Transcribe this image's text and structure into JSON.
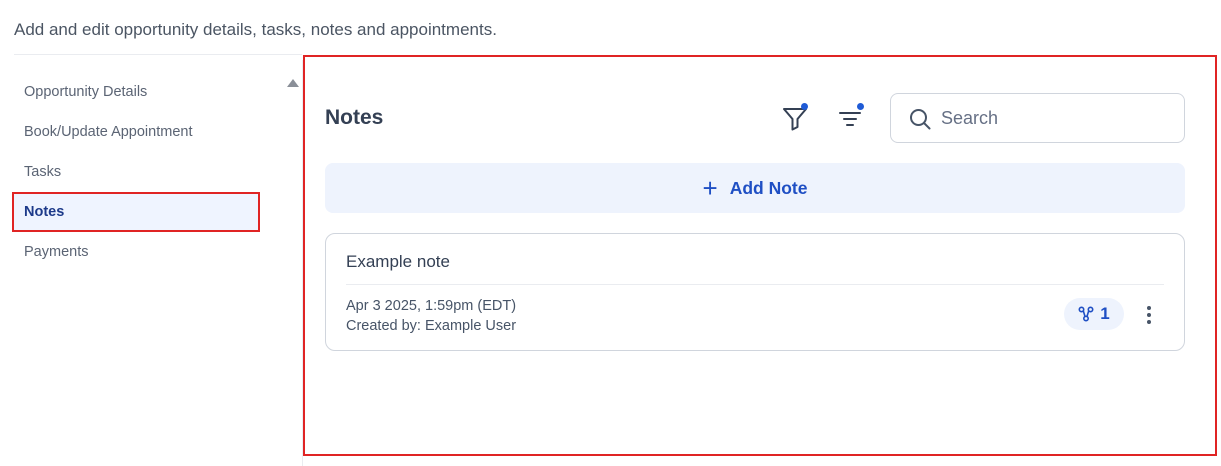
{
  "header": {
    "subtitle": "Add and edit opportunity details, tasks, notes and appointments."
  },
  "sidebar": {
    "items": [
      {
        "label": "Opportunity Details",
        "active": false
      },
      {
        "label": "Book/Update Appointment",
        "active": false
      },
      {
        "label": "Tasks",
        "active": false
      },
      {
        "label": "Notes",
        "active": true
      },
      {
        "label": "Payments",
        "active": false
      }
    ]
  },
  "notes_panel": {
    "title": "Notes",
    "search": {
      "placeholder": "Search",
      "value": ""
    },
    "add_note_label": "Add Note",
    "notes": [
      {
        "title": "Example note",
        "date": "Apr 3 2025, 1:59pm (EDT)",
        "created_by": "Created by: Example User",
        "association_count": "1"
      }
    ]
  },
  "colors": {
    "accent": "#1f4fc4",
    "highlight_border": "#e02424",
    "active_bg": "#eff4ff"
  },
  "icons": {
    "filter": "filter-icon",
    "sort": "sort-icon",
    "search": "search-icon",
    "add": "plus-icon",
    "association": "association-icon",
    "more": "more-vertical-icon",
    "scroll": "scroll-up-icon"
  }
}
